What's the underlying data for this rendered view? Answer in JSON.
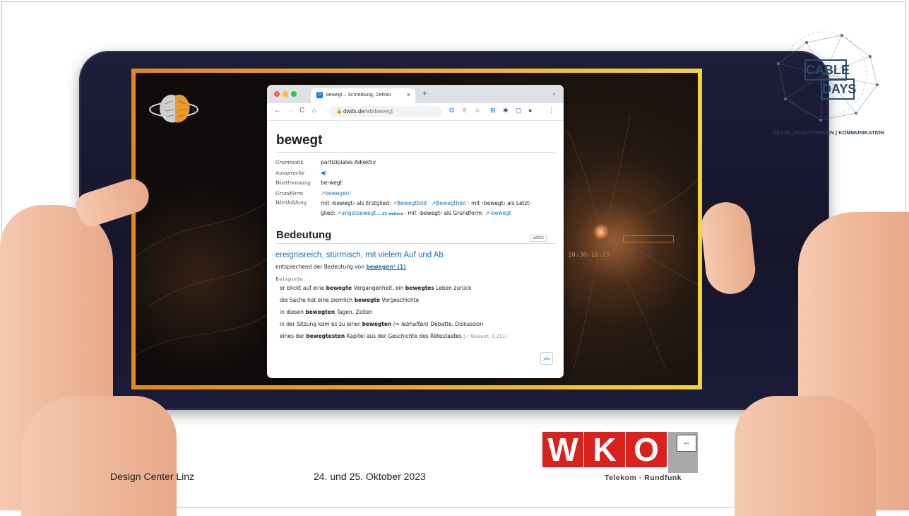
{
  "browser": {
    "tab_title": "bewegt – Schreibung, Definiti",
    "url_domain": "dwds.de",
    "url_path": "/wb/bewegt",
    "tab_favicon": "D"
  },
  "entry": {
    "headword": "bewegt",
    "grammar": [
      {
        "key": "Grammatik",
        "value": "partizipiales Adjektiv"
      },
      {
        "key": "Aussprache",
        "value": "◀)"
      },
      {
        "key": "Worttrennung",
        "value": "be-wegt"
      },
      {
        "key": "Grundform",
        "value": "↗bewegen¹"
      }
    ],
    "wortbildung_key": "Wortbildung",
    "wortbildung_line1_a": "mit ›bewegt‹ als Erstglied: ",
    "wortbildung_link1": "↗Bewegtbild",
    "wortbildung_sep": " · ",
    "wortbildung_link2": "↗Bewegtheit",
    "wortbildung_line1_b": " · mit ›bewegt‹ als Letzt-",
    "wortbildung_line2_a": "glied: ",
    "wortbildung_link3": "↗angstbewegt",
    "wortbildung_more": " … 13 weitere ",
    "wortbildung_line2_b": "· mit ›bewegt‹ als Grundform: ",
    "wortbildung_link4": "↗-bewegt",
    "section_title": "Bedeutung",
    "badge": "eWDG",
    "definition": "ereignisreich, stürmisch, mit vielem Auf und Ab",
    "sub_prefix": "entsprechend der Bedeutung von ",
    "sub_link": "bewegen¹ (1)",
    "examples_label": "Beispiele:",
    "examples": [
      "er blickt auf eine bewegte Vergangenheit, ein bewegtes Leben zurück",
      "die Sache hat eine ziemlich bewegte Vorgeschichte",
      "in diesen bewegten Tagen, Zeiten",
      "in der Sitzung kam es zu einer bewegten (= lebhaften) Debatte, Diskussion",
      "eines der bewegtesten Kapitel aus der Geschichte des Rätestaates"
    ],
    "example_source": "[↗ Weinert, 8,213]"
  },
  "screen": {
    "timecode": "10:30:16:29"
  },
  "logo_cable": {
    "word1": "CABLE",
    "word2": "DAYS",
    "tagline": "NETZE | PLATTFORMEN | KOMMUNIKATION"
  },
  "logo_wko": {
    "letters": [
      "W",
      "K",
      "O"
    ],
    "subtitle": "Telekom · Rundfunk"
  },
  "footer": {
    "venue": "Design Center Linz",
    "date": "24. und 25. Oktober 2023"
  },
  "colors": {
    "accent_orange": "#e3861b",
    "accent_yellow": "#f6d23a",
    "wko_red": "#d9211d",
    "link_blue": "#1e72ae"
  }
}
